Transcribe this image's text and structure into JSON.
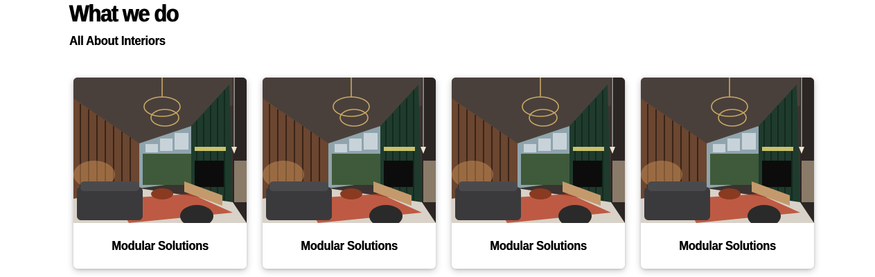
{
  "section": {
    "title": "What we do",
    "subtitle": "All About Interiors"
  },
  "cards": [
    {
      "label": "Modular Solutions",
      "image": "living-room-interior-photo"
    },
    {
      "label": "Modular Solutions",
      "image": "living-room-interior-photo"
    },
    {
      "label": "Modular Solutions",
      "image": "living-room-interior-photo"
    },
    {
      "label": "Modular Solutions",
      "image": "living-room-interior-photo"
    }
  ]
}
